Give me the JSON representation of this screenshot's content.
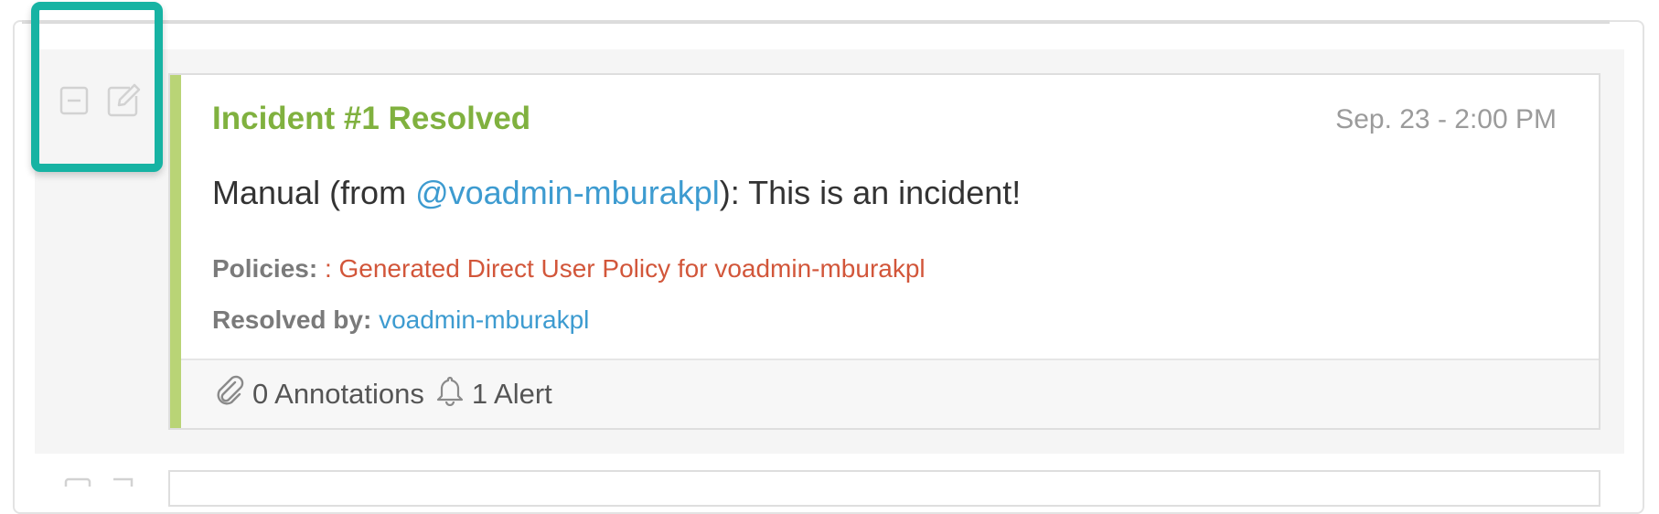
{
  "incident": {
    "title": "Incident #1 Resolved",
    "timestamp": "Sep. 23 - 2:00 PM",
    "message_prefix": "Manual (from ",
    "message_mention": "@voadmin-mburakpl",
    "message_suffix": "): This is an incident!",
    "policies_label": "Policies:",
    "policies_value": ": Generated Direct User Policy for voadmin-mburakpl",
    "resolved_label": "Resolved by:",
    "resolved_value": "voadmin-mburakpl",
    "annotations": "0 Annotations",
    "alerts": "1 Alert"
  },
  "icons": {
    "collapse": "collapse-icon",
    "edit": "edit-icon",
    "paperclip": "paperclip-icon",
    "bell": "bell-icon"
  },
  "colors": {
    "highlight": "#17b3a3",
    "resolved_green": "#80b13f",
    "accent_bar": "#b9d476",
    "link_blue": "#3d9bd0",
    "policy_red": "#d2563a"
  }
}
